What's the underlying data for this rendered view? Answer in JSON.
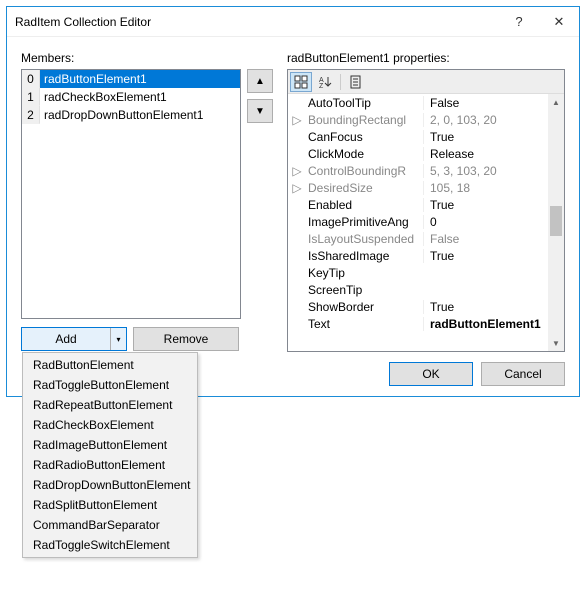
{
  "window": {
    "title": "RadItem Collection Editor",
    "help": "?",
    "close": "✕"
  },
  "members": {
    "label": "Members:",
    "items": [
      {
        "index": "0",
        "name": "radButtonElement1",
        "selected": true
      },
      {
        "index": "1",
        "name": "radCheckBoxElement1",
        "selected": false
      },
      {
        "index": "2",
        "name": "radDropDownButtonElement1",
        "selected": false
      }
    ],
    "up": "▲",
    "down": "▼",
    "add": "Add",
    "add_drop_glyph": "▾",
    "remove": "Remove",
    "dropdown": [
      "RadButtonElement",
      "RadToggleButtonElement",
      "RadRepeatButtonElement",
      "RadCheckBoxElement",
      "RadImageButtonElement",
      "RadRadioButtonElement",
      "RadDropDownButtonElement",
      "RadSplitButtonElement",
      "CommandBarSeparator",
      "RadToggleSwitchElement"
    ]
  },
  "properties": {
    "label": "radButtonElement1 properties:",
    "rows": [
      {
        "expand": "",
        "name": "AutoToolTip",
        "value": "False",
        "ro": false,
        "bold": false
      },
      {
        "expand": "▷",
        "name": "BoundingRectangl",
        "value": "2, 0, 103, 20",
        "ro": true,
        "bold": false
      },
      {
        "expand": "",
        "name": "CanFocus",
        "value": "True",
        "ro": false,
        "bold": false
      },
      {
        "expand": "",
        "name": "ClickMode",
        "value": "Release",
        "ro": false,
        "bold": false
      },
      {
        "expand": "▷",
        "name": "ControlBoundingR",
        "value": "5, 3, 103, 20",
        "ro": true,
        "bold": false
      },
      {
        "expand": "▷",
        "name": "DesiredSize",
        "value": "105, 18",
        "ro": true,
        "bold": false
      },
      {
        "expand": "",
        "name": "Enabled",
        "value": "True",
        "ro": false,
        "bold": false
      },
      {
        "expand": "",
        "name": "ImagePrimitiveAng",
        "value": "0",
        "ro": false,
        "bold": false
      },
      {
        "expand": "",
        "name": "IsLayoutSuspended",
        "value": "False",
        "ro": true,
        "bold": false
      },
      {
        "expand": "",
        "name": "IsSharedImage",
        "value": "True",
        "ro": false,
        "bold": false
      },
      {
        "expand": "",
        "name": "KeyTip",
        "value": "",
        "ro": false,
        "bold": false
      },
      {
        "expand": "",
        "name": "ScreenTip",
        "value": "",
        "ro": false,
        "bold": false
      },
      {
        "expand": "",
        "name": "ShowBorder",
        "value": "True",
        "ro": false,
        "bold": false
      },
      {
        "expand": "",
        "name": "Text",
        "value": "radButtonElement1",
        "ro": false,
        "bold": true
      }
    ]
  },
  "buttons": {
    "ok": "OK",
    "cancel": "Cancel"
  }
}
